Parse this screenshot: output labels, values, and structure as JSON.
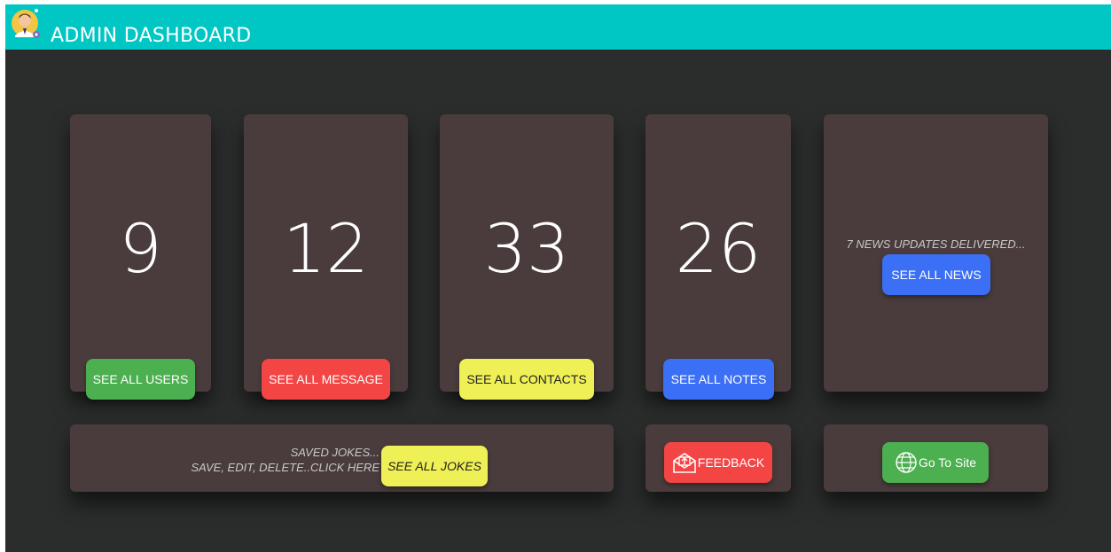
{
  "header": {
    "title": "ADMIN DASHBOARD",
    "logo_icon": "admin-avatar-icon"
  },
  "stats": [
    {
      "value": "9",
      "button": "SEE ALL USERS",
      "color": "#4caf50"
    },
    {
      "value": "12",
      "button": "SEE ALL MESSAGE",
      "color": "#f44545"
    },
    {
      "value": "33",
      "button": "SEE ALL CONTACTS",
      "color": "#efef56"
    },
    {
      "value": "26",
      "button": "SEE ALL NOTES",
      "color": "#3b6ff5"
    }
  ],
  "news": {
    "text": "7 NEWS UPDATES DELIVERED...",
    "button": "SEE ALL NEWS"
  },
  "jokes": {
    "line1": "SAVED JOKES...",
    "line2": "SAVE, EDIT, DELETE..CLICK HERE",
    "button": "SEE ALL JOKES"
  },
  "feedback": {
    "button": "FEEDBACK",
    "icon": "envelope-upload-icon"
  },
  "site": {
    "button": "Go To Site",
    "icon": "globe-www-icon"
  },
  "colors": {
    "topbar": "#00c6c4",
    "background": "#2a2d2c",
    "card": "#4a3c3c"
  }
}
